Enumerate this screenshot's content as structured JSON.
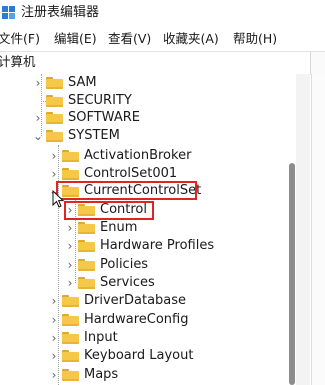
{
  "window": {
    "title": "注册表编辑器"
  },
  "menu": [
    "文件(F)",
    "编辑(E)",
    "查看(V)",
    "收藏夹(A)",
    "帮助(H)"
  ],
  "address": "计算机",
  "tree": {
    "n_sam": "SAM",
    "n_security": "SECURITY",
    "n_software": "SOFTWARE",
    "n_system": "SYSTEM",
    "n_activationbroker": "ActivationBroker",
    "n_controlset001": "ControlSet001",
    "n_currentcontrolset": "CurrentControlSet",
    "n_control": "Control",
    "n_enum": "Enum",
    "n_hardwareprofiles": "Hardware Profiles",
    "n_policies": "Policies",
    "n_services": "Services",
    "n_driverdatabase": "DriverDatabase",
    "n_hardwareconfig": "HardwareConfig",
    "n_input": "Input",
    "n_keyboardlayout": "Keyboard Layout",
    "n_maps": "Maps"
  },
  "icons": {
    "app": "regedit-icon",
    "collapsed": "chevron-right-icon",
    "expanded": "chevron-down-icon",
    "folder": "folder-icon",
    "cursor": "mouse-pointer-icon"
  },
  "colors": {
    "highlight_box": "#e02424",
    "folder": "#f5c84a",
    "scroll_thumb": "#8d8d8d"
  }
}
